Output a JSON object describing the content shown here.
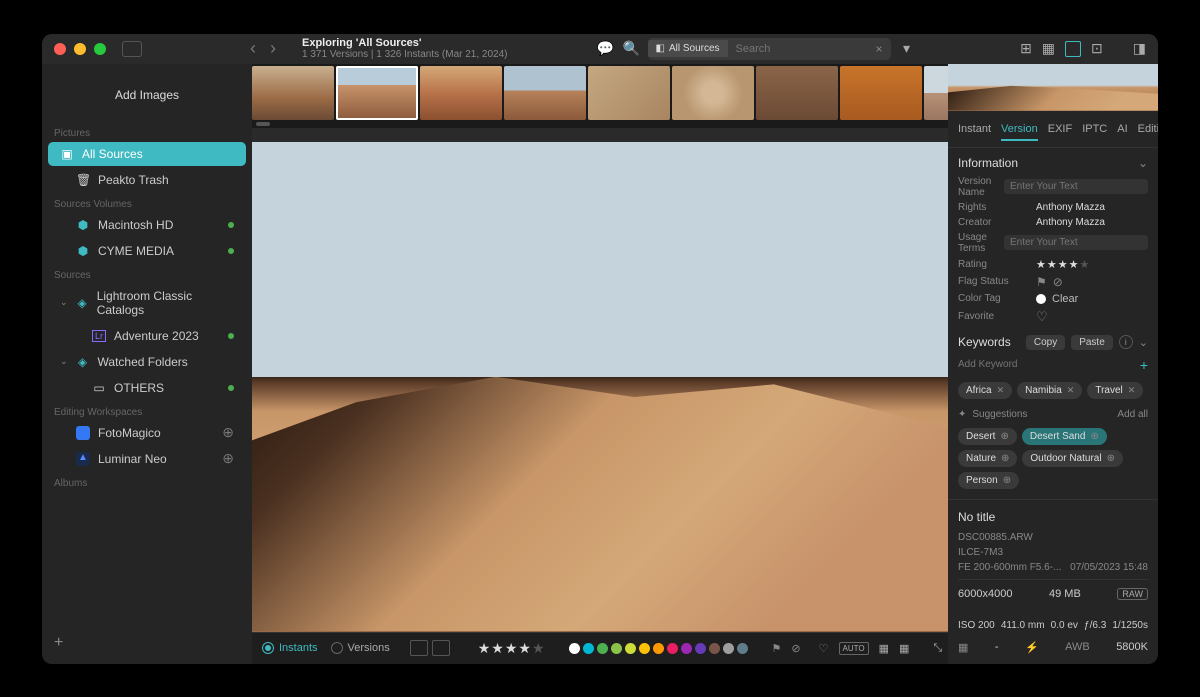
{
  "titlebar": {
    "title": "Exploring 'All Sources'",
    "subtitle": "1 371 Versions | 1 326 Instants (Mar 21, 2024)",
    "search_tag": "All Sources",
    "search_placeholder": "Search"
  },
  "sidebar": {
    "add_images": "Add Images",
    "labels": {
      "pictures": "Pictures",
      "volumes": "Sources Volumes",
      "sources": "Sources",
      "editing": "Editing Workspaces",
      "albums": "Albums"
    },
    "pictures": [
      {
        "label": "All Sources",
        "active": true
      },
      {
        "label": "Peakto Trash"
      }
    ],
    "volumes": [
      {
        "label": "Macintosh HD",
        "dot": true
      },
      {
        "label": "CYME MEDIA",
        "dot": true
      }
    ],
    "sources_items": {
      "lr": "Lightroom Classic Catalogs",
      "lr_child": "Adventure 2023",
      "watched": "Watched Folders",
      "watched_child": "OTHERS"
    },
    "editing": [
      {
        "label": "FotoMagico"
      },
      {
        "label": "Luminar Neo"
      }
    ]
  },
  "bottombar": {
    "instants": "Instants",
    "versions": "Versions",
    "auto": "AUTO"
  },
  "color_dots": [
    "#ffffff",
    "#00b8d4",
    "#4caf50",
    "#8bc34a",
    "#cddc39",
    "#ffc107",
    "#ff9800",
    "#e91e63",
    "#9c27b0",
    "#673ab7",
    "#795548",
    "#9e9e9e",
    "#607d8b"
  ],
  "stars_rating": 4,
  "inspector": {
    "tabs": [
      "Instant",
      "Version",
      "EXIF",
      "IPTC",
      "AI",
      "Edition"
    ],
    "active_tab": "Version",
    "info": {
      "header": "Information",
      "version_name_lbl": "Version Name",
      "version_name_ph": "Enter Your Text",
      "rights_lbl": "Rights",
      "rights_val": "Anthony Mazza",
      "creator_lbl": "Creator",
      "creator_val": "Anthony Mazza",
      "usage_lbl": "Usage Terms",
      "usage_ph": "Enter Your Text",
      "rating_lbl": "Rating",
      "flag_lbl": "Flag Status",
      "color_lbl": "Color Tag",
      "color_val": "Clear",
      "favorite_lbl": "Favorite"
    },
    "keywords": {
      "header": "Keywords",
      "copy": "Copy",
      "paste": "Paste",
      "add_ph": "Add Keyword",
      "tags": [
        "Africa",
        "Namibia",
        "Travel"
      ],
      "suggestions_lbl": "Suggestions",
      "add_all": "Add all",
      "sugg": [
        "Desert",
        "Desert Sand",
        "Nature",
        "Outdoor Natural",
        "Person"
      ],
      "sugg_hl": "Desert Sand"
    },
    "meta": {
      "title": "No title",
      "filename": "DSC00885.ARW",
      "camera": "ILCE-7M3",
      "lens": "FE 200-600mm F5.6-...",
      "date": "07/05/2023 15:48",
      "dimensions": "6000x4000",
      "filesize": "49 MB",
      "raw": "RAW",
      "iso": "ISO 200",
      "focal": "411.0 mm",
      "ev": "0.0 ev",
      "aperture": "ƒ/6.3",
      "shutter": "1/1250s",
      "dash": "-",
      "awb": "AWB",
      "kelvin": "5800K"
    }
  }
}
